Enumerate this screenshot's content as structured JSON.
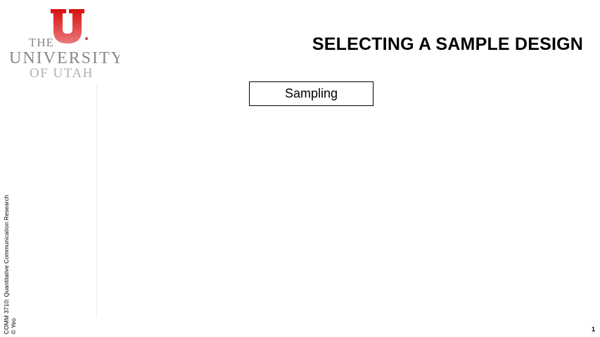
{
  "logo": {
    "line1": "THE",
    "line2": "UNIVERSITY",
    "line3": "OF UTAH",
    "color": "#cc0000"
  },
  "slide": {
    "title": "SELECTING A SAMPLE DESIGN",
    "box_label": "Sampling",
    "page_number": "1"
  },
  "footer": {
    "course": "COMM 3710: Quantitative Communication Research",
    "copyright": "© Yeo"
  }
}
